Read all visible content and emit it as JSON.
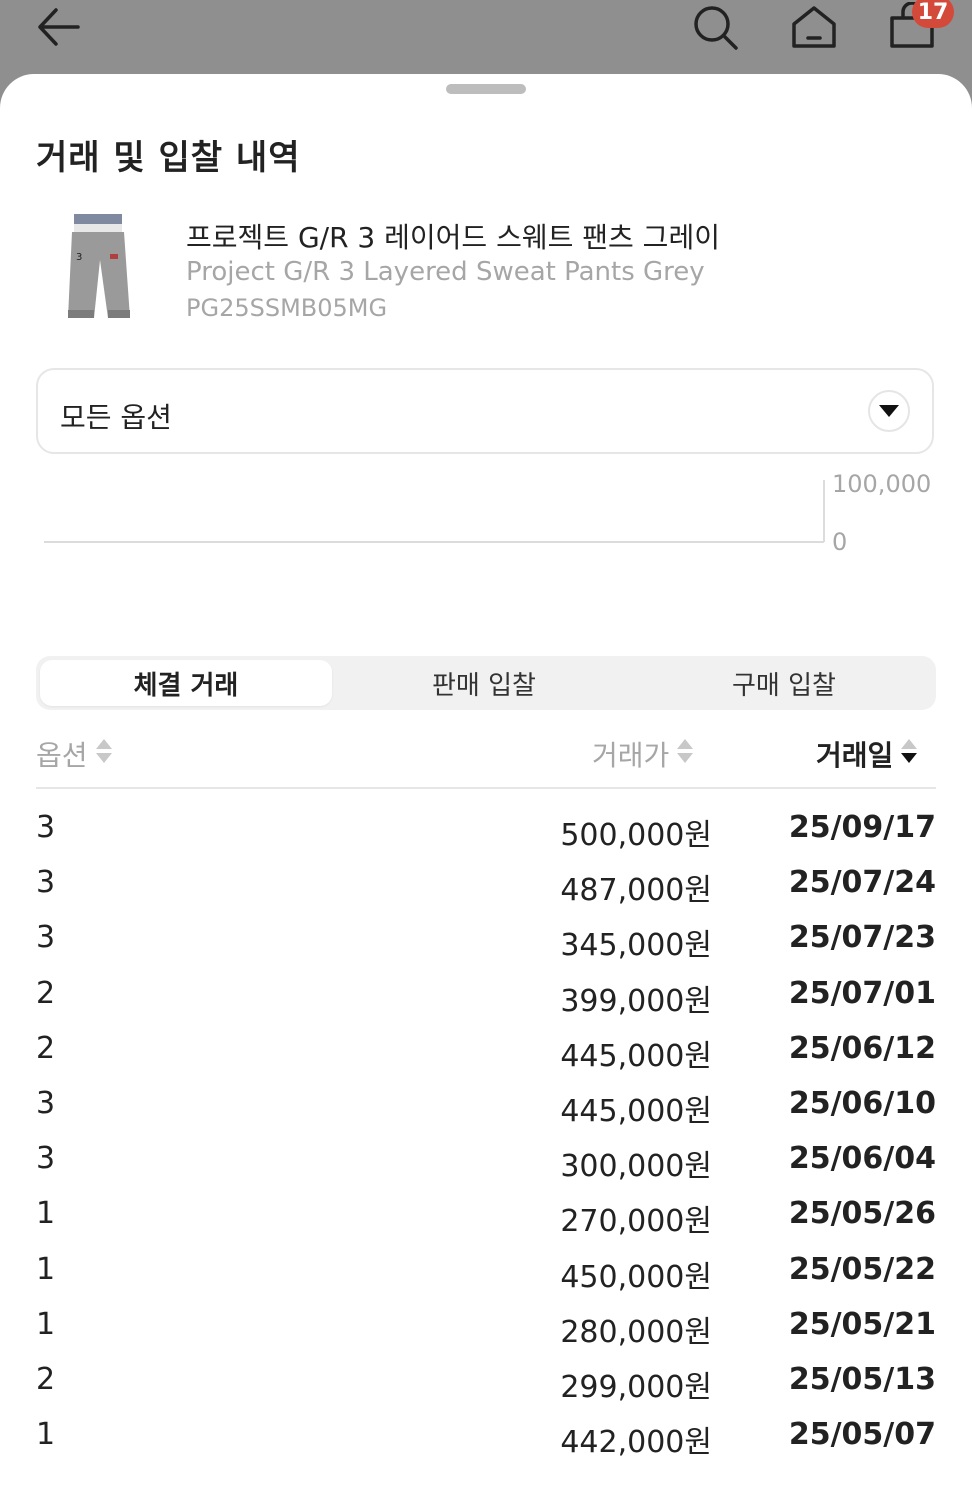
{
  "nav": {
    "cart_count": "17",
    "icons": [
      "back-arrow-icon",
      "search-icon",
      "home-icon",
      "shopping-bag-icon"
    ]
  },
  "sheet": {
    "title": "거래 및 입찰 내역",
    "product": {
      "name_ko": "프로젝트 G/R 3 레이어드 스웨트 팬츠 그레이",
      "name_en": "Project G/R 3 Layered Sweat Pants Grey",
      "code": "PG25SSMB05MG"
    },
    "option_select": {
      "value": "모든 옵션"
    }
  },
  "chart_data": {
    "type": "line",
    "y_ticks": [
      "100,000",
      "0"
    ]
  },
  "tabs": [
    {
      "label": "체결 거래",
      "active": true
    },
    {
      "label": "판매 입찰",
      "active": false
    },
    {
      "label": "구매 입찰",
      "active": false
    }
  ],
  "table": {
    "headers": {
      "option": "옵션",
      "price": "거래가",
      "date": "거래일"
    },
    "rows": [
      {
        "option": "3",
        "price": "500,000원",
        "date": "25/09/17"
      },
      {
        "option": "3",
        "price": "487,000원",
        "date": "25/07/24"
      },
      {
        "option": "3",
        "price": "345,000원",
        "date": "25/07/23"
      },
      {
        "option": "2",
        "price": "399,000원",
        "date": "25/07/01"
      },
      {
        "option": "2",
        "price": "445,000원",
        "date": "25/06/12"
      },
      {
        "option": "3",
        "price": "445,000원",
        "date": "25/06/10"
      },
      {
        "option": "3",
        "price": "300,000원",
        "date": "25/06/04"
      },
      {
        "option": "1",
        "price": "270,000원",
        "date": "25/05/26"
      },
      {
        "option": "1",
        "price": "450,000원",
        "date": "25/05/22"
      },
      {
        "option": "1",
        "price": "280,000원",
        "date": "25/05/21"
      },
      {
        "option": "2",
        "price": "299,000원",
        "date": "25/05/13"
      },
      {
        "option": "1",
        "price": "442,000원",
        "date": "25/05/07"
      }
    ]
  },
  "colors": {
    "badge": "#d44a3a",
    "overlay": "#8f8f8f",
    "muted_text": "#a6a6a6"
  }
}
